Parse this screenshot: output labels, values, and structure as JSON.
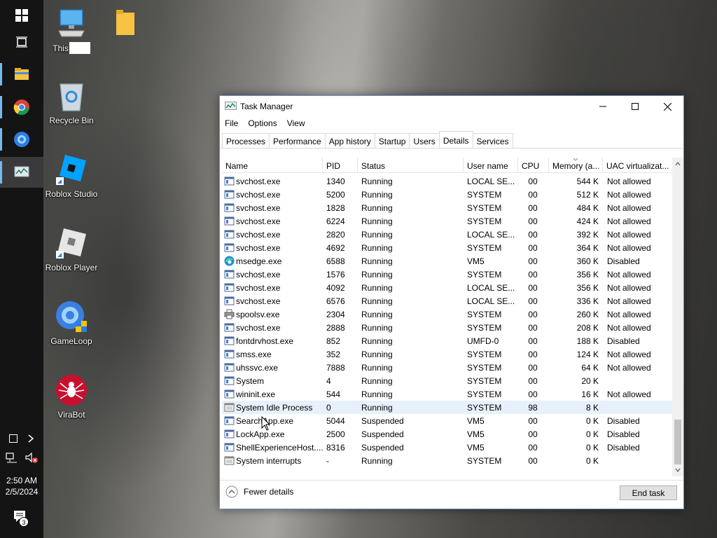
{
  "desktop": {
    "icons": [
      {
        "label": "This"
      },
      {
        "label": ""
      },
      {
        "label": "Recycle Bin"
      },
      {
        "label": "Roblox Studio"
      },
      {
        "label": "Roblox Player"
      },
      {
        "label": "GameLoop"
      },
      {
        "label": "ViraBot"
      }
    ]
  },
  "taskbar": {
    "time": "2:50 AM",
    "date": "2/5/2024",
    "notification_count": "3"
  },
  "window": {
    "title": "Task Manager",
    "menu": [
      "File",
      "Options",
      "View"
    ],
    "tabs": [
      "Processes",
      "Performance",
      "App history",
      "Startup",
      "Users",
      "Details",
      "Services"
    ],
    "active_tab": "Details",
    "columns": [
      "Name",
      "PID",
      "Status",
      "User name",
      "CPU",
      "Memory (a...",
      "UAC virtualizat..."
    ],
    "rows": [
      [
        "svchost.exe",
        "1340",
        "Running",
        "LOCAL SE...",
        "00",
        "544 K",
        "Not allowed"
      ],
      [
        "svchost.exe",
        "5200",
        "Running",
        "SYSTEM",
        "00",
        "512 K",
        "Not allowed"
      ],
      [
        "svchost.exe",
        "1828",
        "Running",
        "SYSTEM",
        "00",
        "484 K",
        "Not allowed"
      ],
      [
        "svchost.exe",
        "6224",
        "Running",
        "SYSTEM",
        "00",
        "424 K",
        "Not allowed"
      ],
      [
        "svchost.exe",
        "2820",
        "Running",
        "LOCAL SE...",
        "00",
        "392 K",
        "Not allowed"
      ],
      [
        "svchost.exe",
        "4692",
        "Running",
        "SYSTEM",
        "00",
        "364 K",
        "Not allowed"
      ],
      [
        "msedge.exe",
        "6588",
        "Running",
        "VM5",
        "00",
        "360 K",
        "Disabled"
      ],
      [
        "svchost.exe",
        "1576",
        "Running",
        "SYSTEM",
        "00",
        "356 K",
        "Not allowed"
      ],
      [
        "svchost.exe",
        "4092",
        "Running",
        "LOCAL SE...",
        "00",
        "356 K",
        "Not allowed"
      ],
      [
        "svchost.exe",
        "6576",
        "Running",
        "LOCAL SE...",
        "00",
        "336 K",
        "Not allowed"
      ],
      [
        "spoolsv.exe",
        "2304",
        "Running",
        "SYSTEM",
        "00",
        "260 K",
        "Not allowed"
      ],
      [
        "svchost.exe",
        "2888",
        "Running",
        "SYSTEM",
        "00",
        "208 K",
        "Not allowed"
      ],
      [
        "fontdrvhost.exe",
        "852",
        "Running",
        "UMFD-0",
        "00",
        "188 K",
        "Disabled"
      ],
      [
        "smss.exe",
        "352",
        "Running",
        "SYSTEM",
        "00",
        "124 K",
        "Not allowed"
      ],
      [
        "uhssvc.exe",
        "7888",
        "Running",
        "SYSTEM",
        "00",
        "64 K",
        "Not allowed"
      ],
      [
        "System",
        "4",
        "Running",
        "SYSTEM",
        "00",
        "20 K",
        ""
      ],
      [
        "wininit.exe",
        "544",
        "Running",
        "SYSTEM",
        "00",
        "16 K",
        "Not allowed"
      ],
      [
        "System Idle Process",
        "0",
        "Running",
        "SYSTEM",
        "98",
        "8 K",
        ""
      ],
      [
        "SearchApp.exe",
        "5044",
        "Suspended",
        "VM5",
        "00",
        "0 K",
        "Disabled"
      ],
      [
        "LockApp.exe",
        "2500",
        "Suspended",
        "VM5",
        "00",
        "0 K",
        "Disabled"
      ],
      [
        "ShellExperienceHost....",
        "8316",
        "Suspended",
        "VM5",
        "00",
        "0 K",
        "Disabled"
      ],
      [
        "System interrupts",
        "-",
        "Running",
        "SYSTEM",
        "00",
        "0 K",
        ""
      ]
    ],
    "row_icons": [
      "svc",
      "svc",
      "svc",
      "svc",
      "svc",
      "svc",
      "edge",
      "svc",
      "svc",
      "svc",
      "printer",
      "svc",
      "svc",
      "svc",
      "svc",
      "svc",
      "svc",
      "sys",
      "svc",
      "svc",
      "svc",
      "sys"
    ],
    "selected_row": 17,
    "fewer_details": "Fewer details",
    "end_task": "End task"
  }
}
